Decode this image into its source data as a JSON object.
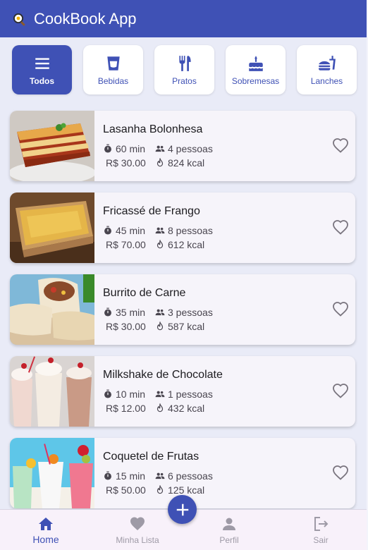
{
  "app": {
    "title": "CookBook App",
    "logo_icon": "frying-pan-icon"
  },
  "colors": {
    "primary": "#3f51b5",
    "card_bg": "#f6f4fa",
    "page_bg": "#e9ebf7"
  },
  "categories": [
    {
      "label": "Todos",
      "icon": "menu-icon",
      "active": true
    },
    {
      "label": "Bebidas",
      "icon": "cup-icon",
      "active": false
    },
    {
      "label": "Pratos",
      "icon": "fork-knife-icon",
      "active": false
    },
    {
      "label": "Sobremesas",
      "icon": "cake-icon",
      "active": false
    },
    {
      "label": "Lanches",
      "icon": "fastfood-icon",
      "active": false
    }
  ],
  "recipes": [
    {
      "name": "Lasanha Bolonhesa",
      "time": "60 min",
      "people": "4 pessoas",
      "price": "R$ 30.00",
      "calories": "824 kcal"
    },
    {
      "name": "Fricassé de Frango",
      "time": "45 min",
      "people": "8 pessoas",
      "price": "R$ 70.00",
      "calories": "612 kcal"
    },
    {
      "name": "Burrito de Carne",
      "time": "35 min",
      "people": "3 pessoas",
      "price": "R$ 30.00",
      "calories": "587 kcal"
    },
    {
      "name": "Milkshake de Chocolate",
      "time": "10 min",
      "people": "1 pessoas",
      "price": "R$ 12.00",
      "calories": "432 kcal"
    },
    {
      "name": "Coquetel de Frutas",
      "time": "15 min",
      "people": "6 pessoas",
      "price": "R$ 50.00",
      "calories": "125 kcal"
    }
  ],
  "fab": {
    "icon": "plus-icon"
  },
  "bottom_nav": [
    {
      "label": "Home",
      "icon": "home-icon",
      "active": true
    },
    {
      "label": "Minha Lista",
      "icon": "heart-icon",
      "active": false
    },
    {
      "label": "Perfil",
      "icon": "person-icon",
      "active": false
    },
    {
      "label": "Sair",
      "icon": "logout-icon",
      "active": false
    }
  ]
}
